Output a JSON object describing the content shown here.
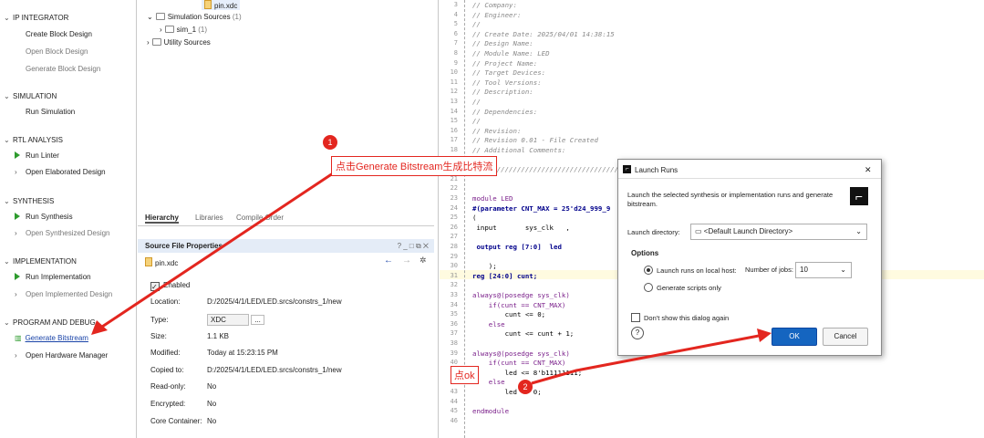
{
  "flow": {
    "ip_integrator": {
      "label": "IP INTEGRATOR",
      "items": [
        "Create Block Design",
        "Open Block Design",
        "Generate Block Design"
      ]
    },
    "simulation": {
      "label": "SIMULATION",
      "items": [
        "Run Simulation"
      ]
    },
    "rtl": {
      "label": "RTL ANALYSIS",
      "items": [
        "Run Linter",
        "Open Elaborated Design"
      ]
    },
    "synthesis": {
      "label": "SYNTHESIS",
      "items": [
        "Run Synthesis",
        "Open Synthesized Design"
      ]
    },
    "implementation": {
      "label": "IMPLEMENTATION",
      "items": [
        "Run Implementation",
        "Open Implemented Design"
      ]
    },
    "program": {
      "label": "PROGRAM AND DEBUG",
      "items": [
        "Generate Bitstream",
        "Open Hardware Manager"
      ]
    }
  },
  "sources": {
    "pin_file": "pin.xdc",
    "sim_sources": "Simulation Sources",
    "sim_count": "(1)",
    "sim_1": "sim_1",
    "sim_1_count": "(1)",
    "utility": "Utility Sources"
  },
  "tabs": [
    "Hierarchy",
    "Libraries",
    "Compile Order"
  ],
  "sfp": {
    "title": "Source File Properties",
    "controls": "? _ □ ⧉ ✕",
    "file": "pin.xdc",
    "enabled": "Enabled",
    "rows": [
      {
        "k": "Location:",
        "v": "D:/2025/4/1/LED/LED.srcs/constrs_1/new"
      },
      {
        "k": "Type:",
        "v": "XDC"
      },
      {
        "k": "Size:",
        "v": "1.1 KB"
      },
      {
        "k": "Modified:",
        "v": "Today at 15:23:15 PM"
      },
      {
        "k": "Copied to:",
        "v": "D:/2025/4/1/LED/LED.srcs/constrs_1/new"
      },
      {
        "k": "Read-only:",
        "v": "No"
      },
      {
        "k": "Encrypted:",
        "v": "No"
      },
      {
        "k": "Core Container:",
        "v": "No"
      }
    ],
    "ellipsis": "..."
  },
  "editor": {
    "lines": [
      {
        "n": "3",
        "t": "// Company:"
      },
      {
        "n": "4",
        "t": "// Engineer:"
      },
      {
        "n": "5",
        "t": "//"
      },
      {
        "n": "6",
        "t": "// Create Date: 2025/04/01 14:38:15"
      },
      {
        "n": "7",
        "t": "// Design Name:"
      },
      {
        "n": "8",
        "t": "// Module Name: LED"
      },
      {
        "n": "9",
        "t": "// Project Name:"
      },
      {
        "n": "10",
        "t": "// Target Devices:"
      },
      {
        "n": "11",
        "t": "// Tool Versions:"
      },
      {
        "n": "12",
        "t": "// Description:"
      },
      {
        "n": "13",
        "t": "//"
      },
      {
        "n": "14",
        "t": "// Dependencies:"
      },
      {
        "n": "15",
        "t": "//"
      },
      {
        "n": "16",
        "t": "// Revision:"
      },
      {
        "n": "17",
        "t": "// Revision 0.01 - File Created"
      },
      {
        "n": "18",
        "t": "// Additional Comments:"
      },
      {
        "n": "19",
        "t": "//"
      },
      {
        "n": "20",
        "t": "//////////////////////////////////////"
      },
      {
        "n": "21",
        "t": ""
      },
      {
        "n": "22",
        "t": ""
      },
      {
        "n": "23",
        "t": "module LED"
      },
      {
        "n": "24",
        "t": "#(parameter CNT_MAX = 25'd24_999_9"
      },
      {
        "n": "25",
        "t": "("
      },
      {
        "n": "26",
        "t": " input       sys_clk   ,"
      },
      {
        "n": "27",
        "t": ""
      },
      {
        "n": "28",
        "t": " output reg [7:0]  led"
      },
      {
        "n": "29",
        "t": ""
      },
      {
        "n": "30",
        "t": "    );"
      },
      {
        "n": "31",
        "t": "reg [24:0] cunt;"
      },
      {
        "n": "32",
        "t": ""
      },
      {
        "n": "33",
        "t": "always@(posedge sys_clk)"
      },
      {
        "n": "34",
        "t": "    if(cunt == CNT_MAX)"
      },
      {
        "n": "35",
        "t": "        cunt <= 0;"
      },
      {
        "n": "36",
        "t": "    else"
      },
      {
        "n": "37",
        "t": "        cunt <= cunt + 1;"
      },
      {
        "n": "38",
        "t": ""
      },
      {
        "n": "39",
        "t": "always@(posedge sys_clk)"
      },
      {
        "n": "40",
        "t": "    if(cunt == CNT_MAX)"
      },
      {
        "n": "41",
        "t": "        led <= 8'b11111111;"
      },
      {
        "n": "42",
        "t": "    else"
      },
      {
        "n": "43",
        "t": "        led <= 0;"
      },
      {
        "n": "44",
        "t": ""
      },
      {
        "n": "45",
        "t": "endmodule"
      },
      {
        "n": "46",
        "t": ""
      }
    ]
  },
  "dialog": {
    "title": "Launch Runs",
    "close": "✕",
    "desc": "Launch the selected synthesis or implementation runs and generate bitstream.",
    "dir_label": "Launch directory:",
    "dir_value": "<Default Launch Directory>",
    "options_label": "Options",
    "opt1": "Launch runs on local host:",
    "jobs_label": "Number of jobs:",
    "jobs_value": "10",
    "opt2": "Generate scripts only",
    "dont_show": "Don't show this dialog again",
    "help": "?",
    "ok": "OK",
    "cancel": "Cancel"
  },
  "annotations": {
    "badge1": "1",
    "callout1": "点击Generate Bitstream生成比特流",
    "badge2": "2",
    "callout2": "点ok"
  },
  "colors": {
    "accent": "#e3261f",
    "ok_button": "#1565c0",
    "link": "#1a44a8",
    "run_green": "#2e9b2e"
  }
}
